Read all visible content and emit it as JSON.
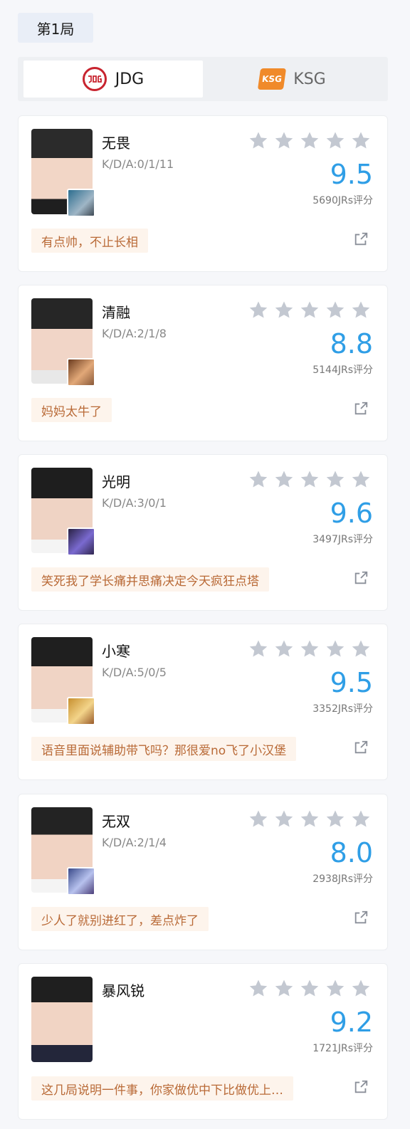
{
  "round": {
    "label": "第1局"
  },
  "teams": [
    {
      "name": "JDG",
      "logo_text": "JDG",
      "active": true,
      "logo_color": "#c8242f"
    },
    {
      "name": "KSG",
      "logo_text": "KSG",
      "active": false,
      "logo_color": "#f08a2a"
    }
  ],
  "players": [
    {
      "name": "无畏",
      "kda": "K/D/A:0/1/11",
      "score": "9.5",
      "votes": "5690JRs评分",
      "comment": "有点帅，不止长相",
      "stars_filled": 0
    },
    {
      "name": "清融",
      "kda": "K/D/A:2/1/8",
      "score": "8.8",
      "votes": "5144JRs评分",
      "comment": "妈妈太牛了",
      "stars_filled": 0
    },
    {
      "name": "光明",
      "kda": "K/D/A:3/0/1",
      "score": "9.6",
      "votes": "3497JRs评分",
      "comment": "笑死我了学长痛并思痛决定今天疯狂点塔",
      "stars_filled": 0
    },
    {
      "name": "小寒",
      "kda": "K/D/A:5/0/5",
      "score": "9.5",
      "votes": "3352JRs评分",
      "comment": "语音里面说辅助带飞吗？那很爱no飞了小汉堡",
      "stars_filled": 0
    },
    {
      "name": "无双",
      "kda": "K/D/A:2/1/4",
      "score": "8.0",
      "votes": "2938JRs评分",
      "comment": "少人了就别进红了，差点炸了",
      "stars_filled": 0
    },
    {
      "name": "暴风锐",
      "kda": "",
      "score": "9.2",
      "votes": "1721JRs评分",
      "comment": "这几局说明一件事，你家做优中下比做优上…",
      "stars_filled": 0
    }
  ],
  "colors": {
    "score": "#2f9ee6",
    "star_empty": "#c3c8d1",
    "comment_bg": "#fdf4ec",
    "comment_text": "#b96a37"
  },
  "icons": {
    "star": "star-icon",
    "share": "share-icon",
    "hero": "hero-portrait-icon"
  }
}
